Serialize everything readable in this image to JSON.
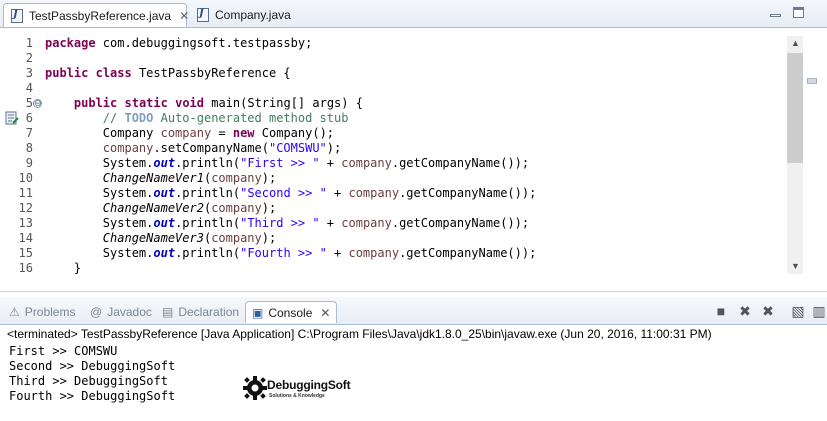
{
  "editor": {
    "tabs": [
      {
        "label": "TestPassbyReference.java",
        "close": "✕"
      },
      {
        "label": "Company.java"
      }
    ],
    "line_numbers": [
      "1",
      "2",
      "3",
      "4",
      "5",
      "6",
      "7",
      "8",
      "9",
      "10",
      "11",
      "12",
      "13",
      "14",
      "15",
      "16"
    ],
    "fold_line": "5",
    "fold_glyph": "⊖"
  },
  "views": {
    "tabs": [
      {
        "label": "Problems",
        "icon": "problems-icon"
      },
      {
        "label": "Javadoc",
        "icon": "javadoc-icon"
      },
      {
        "label": "Declaration",
        "icon": "declaration-icon"
      },
      {
        "label": "Console",
        "icon": "console-icon",
        "close": "✕"
      }
    ]
  },
  "console": {
    "status": "<terminated> TestPassbyReference [Java Application] C:\\Program Files\\Java\\jdk1.8.0_25\\bin\\javaw.exe (Jun 20, 2016, 11:00:31 PM)",
    "output": [
      "First >> COMSWU",
      "Second >> DebuggingSoft",
      "Third >> DebuggingSoft",
      "Fourth >> DebuggingSoft"
    ]
  },
  "watermark": {
    "text": "DebuggingSoft",
    "tagline": "Solutions & Knowledge"
  },
  "colors": {
    "keyword": "#7f0055",
    "string": "#2a00ff",
    "comment": "#3f7f5f",
    "field": "#0000c0"
  }
}
